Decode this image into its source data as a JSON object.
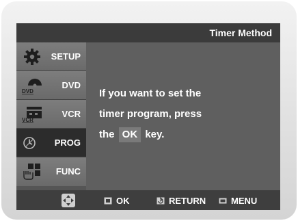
{
  "header": {
    "title": "Timer Method"
  },
  "sidebar": {
    "items": [
      {
        "label": "SETUP",
        "icon": "gear-icon",
        "active": false
      },
      {
        "label": "DVD",
        "icon": "dvd-icon",
        "active": false
      },
      {
        "label": "VCR",
        "icon": "vcr-icon",
        "active": false
      },
      {
        "label": "PROG",
        "icon": "clock-icon",
        "active": true
      },
      {
        "label": "FUNC",
        "icon": "function-icon",
        "active": false
      }
    ]
  },
  "main": {
    "message_lines": [
      "If you want to set the",
      "timer program, press"
    ],
    "line3_prefix": "the",
    "key_label": "OK",
    "line3_suffix": "key."
  },
  "footer": {
    "navigate_icon": "dpad-icon",
    "ok_label": "OK",
    "return_label": "RETURN",
    "menu_label": "MENU"
  },
  "colors": {
    "screen": "#5f5f5f",
    "titlebar": "#3b3b3b",
    "active_item": "#2c2c2c",
    "menu_item": "#757575",
    "text": "#ffffff"
  }
}
